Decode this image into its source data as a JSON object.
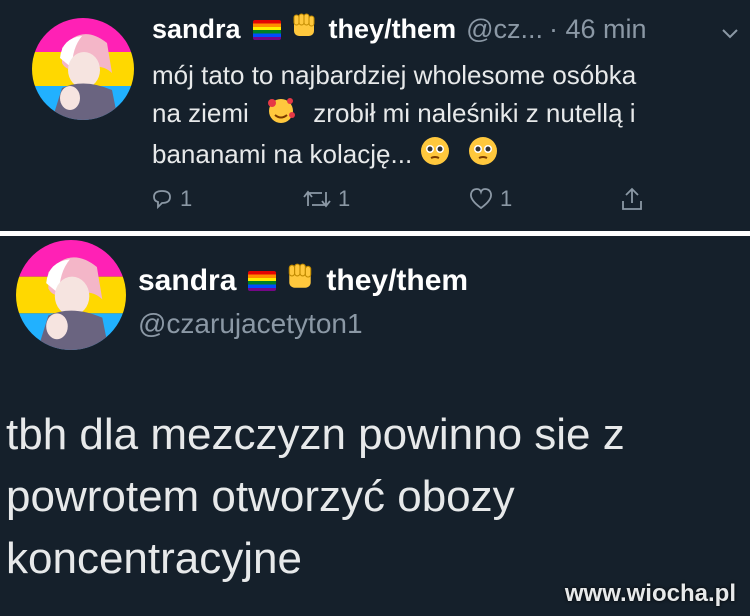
{
  "tweet1": {
    "name": "sandra",
    "pronouns": "they/them",
    "handle": "@cz...",
    "time": "· 46 min",
    "lines": [
      "mój tato to najbardziej wholesome osóbka",
      "na ziemi",
      "zrobił mi naleśniki z nutellą i",
      "bananami na kolację..."
    ],
    "replies": "1",
    "retweets": "1",
    "likes": "1"
  },
  "tweet2": {
    "name": "sandra",
    "pronouns": "they/them",
    "handle": "@czarujacetyton1",
    "lines": [
      "tbh dla mezczyzn powinno sie z",
      "powrotem otworzyć obozy",
      "koncentracyjne"
    ]
  },
  "watermark": "www.wiocha.pl"
}
